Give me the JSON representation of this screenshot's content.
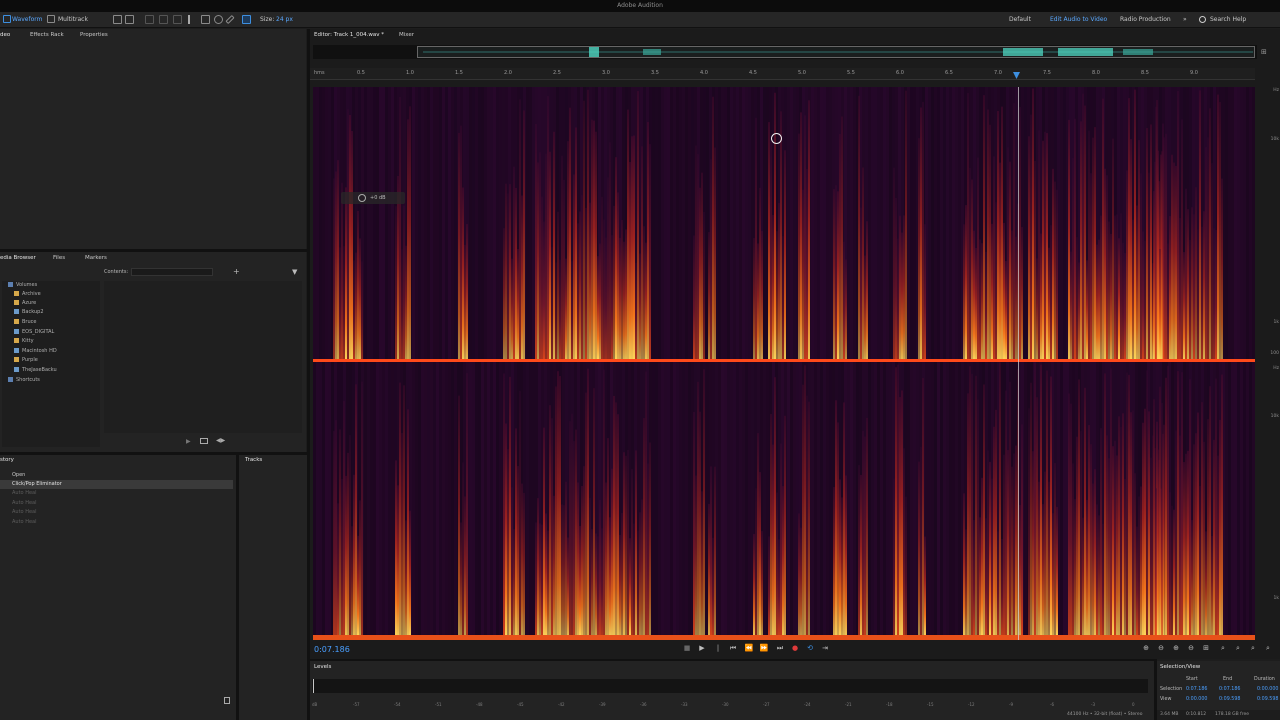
{
  "app": {
    "title": "Adobe Audition"
  },
  "toolbar": {
    "waveform_label": "Waveform",
    "multitrack_label": "Multitrack",
    "size_label": "Size:",
    "size_value": "24 px",
    "workspaces": [
      "Default",
      "Edit Audio to Video",
      "Radio Production"
    ],
    "search_placeholder": "Search Help"
  },
  "left_top_tabs": [
    "deo",
    "Effects Rack",
    "Properties"
  ],
  "media_browser": {
    "tabs": [
      "edia Browser",
      "Files",
      "Markers"
    ],
    "contents_label": "Contents:",
    "tree": [
      {
        "label": "Volumes",
        "color": "#5c7fb0"
      },
      {
        "label": "Archive",
        "color": "#d6a84a"
      },
      {
        "label": "Azure",
        "color": "#d6a84a"
      },
      {
        "label": "Backup2",
        "color": "#6b9ac9"
      },
      {
        "label": "Bruce",
        "color": "#d6a84a"
      },
      {
        "label": "EOS_DIGITAL",
        "color": "#6b9ac9"
      },
      {
        "label": "Kitty",
        "color": "#d6a84a"
      },
      {
        "label": "Macintosh HD",
        "color": "#6b9ac9"
      },
      {
        "label": "Purple",
        "color": "#d6a84a"
      },
      {
        "label": "TheJaseBacku",
        "color": "#6b9ac9"
      },
      {
        "label": "Shortcuts",
        "color": "#5c7fb0"
      }
    ]
  },
  "history": {
    "tab": "story",
    "tracks_tab": "Tracks",
    "items": [
      {
        "label": "Open",
        "state": "normal"
      },
      {
        "label": "Click/Pop Eliminator",
        "state": "selected"
      },
      {
        "label": "Auto Heal",
        "state": "disabled"
      },
      {
        "label": "Auto Heal",
        "state": "disabled"
      },
      {
        "label": "Auto Heal",
        "state": "disabled"
      },
      {
        "label": "Auto Heal",
        "state": "disabled"
      }
    ]
  },
  "editor": {
    "tab_label": "Editor: Track 1_004.wav *",
    "mixer_label": "Mixer",
    "ruler_unit": "hms",
    "ruler_ticks": [
      "0.5",
      "1.0",
      "1.5",
      "2.0",
      "2.5",
      "3.0",
      "3.5",
      "4.0",
      "4.5",
      "5.0",
      "5.5",
      "6.0",
      "6.5",
      "7.0",
      "7.5",
      "8.0",
      "8.5",
      "9.0"
    ],
    "hud_value": "+0 dB",
    "freq_labels_top": [
      "Hz",
      "10k",
      "1k",
      "100"
    ],
    "freq_labels_bottom": [
      "Hz",
      "10k",
      "1k"
    ],
    "current_time": "0:07.186",
    "playhead_fraction": 0.748
  },
  "levels": {
    "tab": "Levels",
    "ticks": [
      "dB",
      "-57",
      "-54",
      "-51",
      "-48",
      "-45",
      "-42",
      "-39",
      "-36",
      "-33",
      "-30",
      "-27",
      "-24",
      "-21",
      "-18",
      "-15",
      "-12",
      "-9",
      "-6",
      "-3",
      "0"
    ]
  },
  "selection_view": {
    "tab": "Selection/View",
    "headers": [
      "Start",
      "End",
      "Duration"
    ],
    "selection_label": "Selection",
    "selection_values": [
      "0:07.186",
      "0:07.186",
      "0:00.000"
    ],
    "view_label": "View",
    "view_values": [
      "0:00.000",
      "0:09.598",
      "0:09.598"
    ]
  },
  "status": {
    "text": "44100 Hz • 32-bit (float) • Stereo",
    "size1": "3.64 MB",
    "duration": "0:10.812",
    "free": "178.18 GB free"
  },
  "colors": {
    "accent": "#3d8fe0",
    "selected_row": "#3a3a3a"
  }
}
